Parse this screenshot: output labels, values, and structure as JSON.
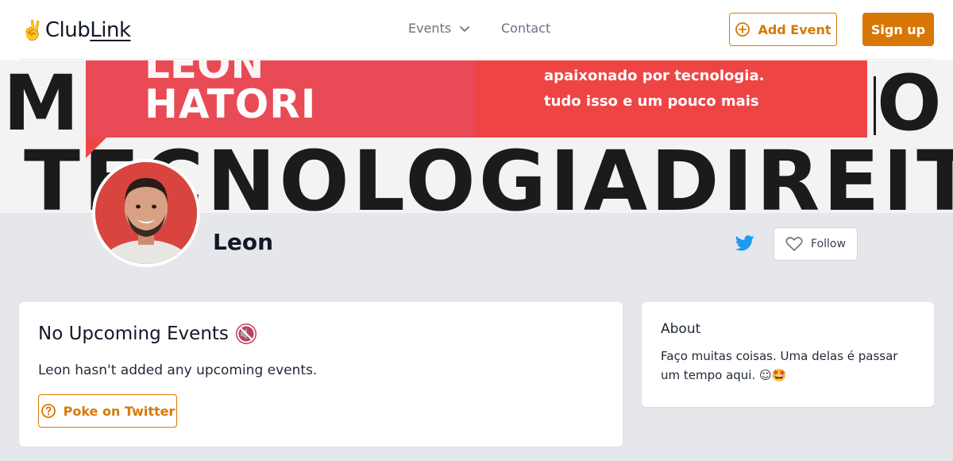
{
  "header": {
    "logo_hand": "✌️",
    "logo_part1": "Club",
    "logo_part2": "Link",
    "nav_events": "Events",
    "nav_contact": "Contact",
    "add_event_label": "Add Event",
    "signup_label": "Sign up"
  },
  "banner": {
    "name_top": "LEON",
    "name": "HATORI",
    "line1": "apaixonado por tecnologia.",
    "line2": "tudo isso e um pouco mais",
    "big_left": "M",
    "big_right": "O",
    "big_text": "TECNOLOGIADIREIT"
  },
  "profile": {
    "name": "Leon",
    "follow_label": "Follow"
  },
  "events_card": {
    "title": "No Upcoming Events",
    "text": "Leon hasn't added any upcoming events.",
    "poke_label": "Poke on Twitter"
  },
  "about_card": {
    "title": "About",
    "text": "Faço muitas coisas. Uma delas é passar um tempo aqui. ☺🤩"
  },
  "colors": {
    "accent": "#d97706",
    "banner_red": "#ef4444",
    "page_bg": "#e5e7eb",
    "twitter": "#1d9bf0"
  },
  "icons": {
    "events_dropdown": "chevron-down-icon",
    "add_event": "plus-circle-icon",
    "twitter": "twitter-icon",
    "follow": "heart-icon",
    "title_emoji": "muted-speaker-icon",
    "poke": "question-circle-icon"
  }
}
